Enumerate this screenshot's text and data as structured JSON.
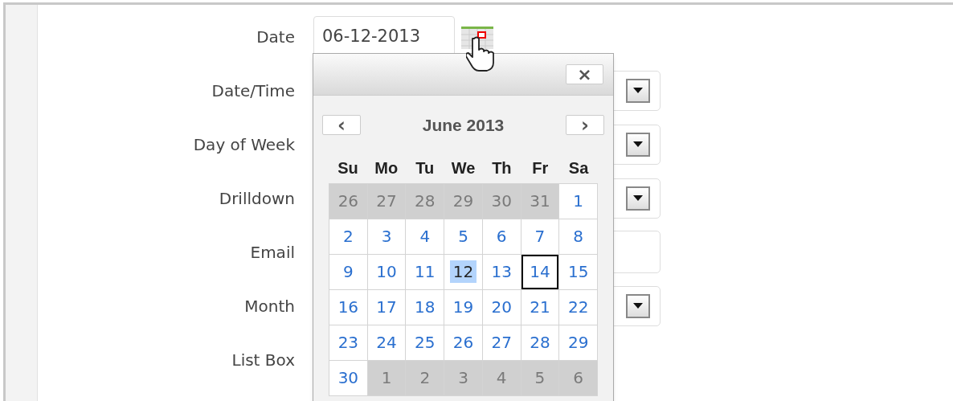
{
  "fields": [
    {
      "label": "Date",
      "kind": "date",
      "value": "06-12-2013"
    },
    {
      "label": "Date/Time",
      "kind": "select"
    },
    {
      "label": "Day of Week",
      "kind": "select"
    },
    {
      "label": "Drilldown",
      "kind": "select"
    },
    {
      "label": "Email",
      "kind": "text"
    },
    {
      "label": "Month",
      "kind": "select"
    },
    {
      "label": "List Box",
      "kind": "listbox"
    }
  ],
  "datepicker": {
    "close": "×",
    "prev": "‹",
    "next": "›",
    "month_title": "June 2013",
    "weekdays": [
      "Su",
      "Mo",
      "Tu",
      "We",
      "Th",
      "Fr",
      "Sa"
    ],
    "days": [
      {
        "day": "26",
        "kind": "other",
        "selected": false,
        "today": false
      },
      {
        "day": "27",
        "kind": "other",
        "selected": false,
        "today": false
      },
      {
        "day": "28",
        "kind": "other",
        "selected": false,
        "today": false
      },
      {
        "day": "29",
        "kind": "other",
        "selected": false,
        "today": false
      },
      {
        "day": "30",
        "kind": "other",
        "selected": false,
        "today": false
      },
      {
        "day": "31",
        "kind": "other",
        "selected": false,
        "today": false
      },
      {
        "day": "1",
        "kind": "current",
        "selected": false,
        "today": false
      },
      {
        "day": "2",
        "kind": "current",
        "selected": false,
        "today": false
      },
      {
        "day": "3",
        "kind": "current",
        "selected": false,
        "today": false
      },
      {
        "day": "4",
        "kind": "current",
        "selected": false,
        "today": false
      },
      {
        "day": "5",
        "kind": "current",
        "selected": false,
        "today": false
      },
      {
        "day": "6",
        "kind": "current",
        "selected": false,
        "today": false
      },
      {
        "day": "7",
        "kind": "current",
        "selected": false,
        "today": false
      },
      {
        "day": "8",
        "kind": "current",
        "selected": false,
        "today": false
      },
      {
        "day": "9",
        "kind": "current",
        "selected": false,
        "today": false
      },
      {
        "day": "10",
        "kind": "current",
        "selected": false,
        "today": false
      },
      {
        "day": "11",
        "kind": "current",
        "selected": false,
        "today": false
      },
      {
        "day": "12",
        "kind": "current",
        "selected": true,
        "today": false
      },
      {
        "day": "13",
        "kind": "current",
        "selected": false,
        "today": false
      },
      {
        "day": "14",
        "kind": "current",
        "selected": false,
        "today": true
      },
      {
        "day": "15",
        "kind": "current",
        "selected": false,
        "today": false
      },
      {
        "day": "16",
        "kind": "current",
        "selected": false,
        "today": false
      },
      {
        "day": "17",
        "kind": "current",
        "selected": false,
        "today": false
      },
      {
        "day": "18",
        "kind": "current",
        "selected": false,
        "today": false
      },
      {
        "day": "19",
        "kind": "current",
        "selected": false,
        "today": false
      },
      {
        "day": "20",
        "kind": "current",
        "selected": false,
        "today": false
      },
      {
        "day": "21",
        "kind": "current",
        "selected": false,
        "today": false
      },
      {
        "day": "22",
        "kind": "current",
        "selected": false,
        "today": false
      },
      {
        "day": "23",
        "kind": "current",
        "selected": false,
        "today": false
      },
      {
        "day": "24",
        "kind": "current",
        "selected": false,
        "today": false
      },
      {
        "day": "25",
        "kind": "current",
        "selected": false,
        "today": false
      },
      {
        "day": "26",
        "kind": "current",
        "selected": false,
        "today": false
      },
      {
        "day": "27",
        "kind": "current",
        "selected": false,
        "today": false
      },
      {
        "day": "28",
        "kind": "current",
        "selected": false,
        "today": false
      },
      {
        "day": "29",
        "kind": "current",
        "selected": false,
        "today": false
      },
      {
        "day": "30",
        "kind": "current",
        "selected": false,
        "today": false
      },
      {
        "day": "1",
        "kind": "other",
        "selected": false,
        "today": false
      },
      {
        "day": "2",
        "kind": "other",
        "selected": false,
        "today": false
      },
      {
        "day": "3",
        "kind": "other",
        "selected": false,
        "today": false
      },
      {
        "day": "4",
        "kind": "other",
        "selected": false,
        "today": false
      },
      {
        "day": "5",
        "kind": "other",
        "selected": false,
        "today": false
      },
      {
        "day": "6",
        "kind": "other",
        "selected": false,
        "today": false
      }
    ]
  }
}
